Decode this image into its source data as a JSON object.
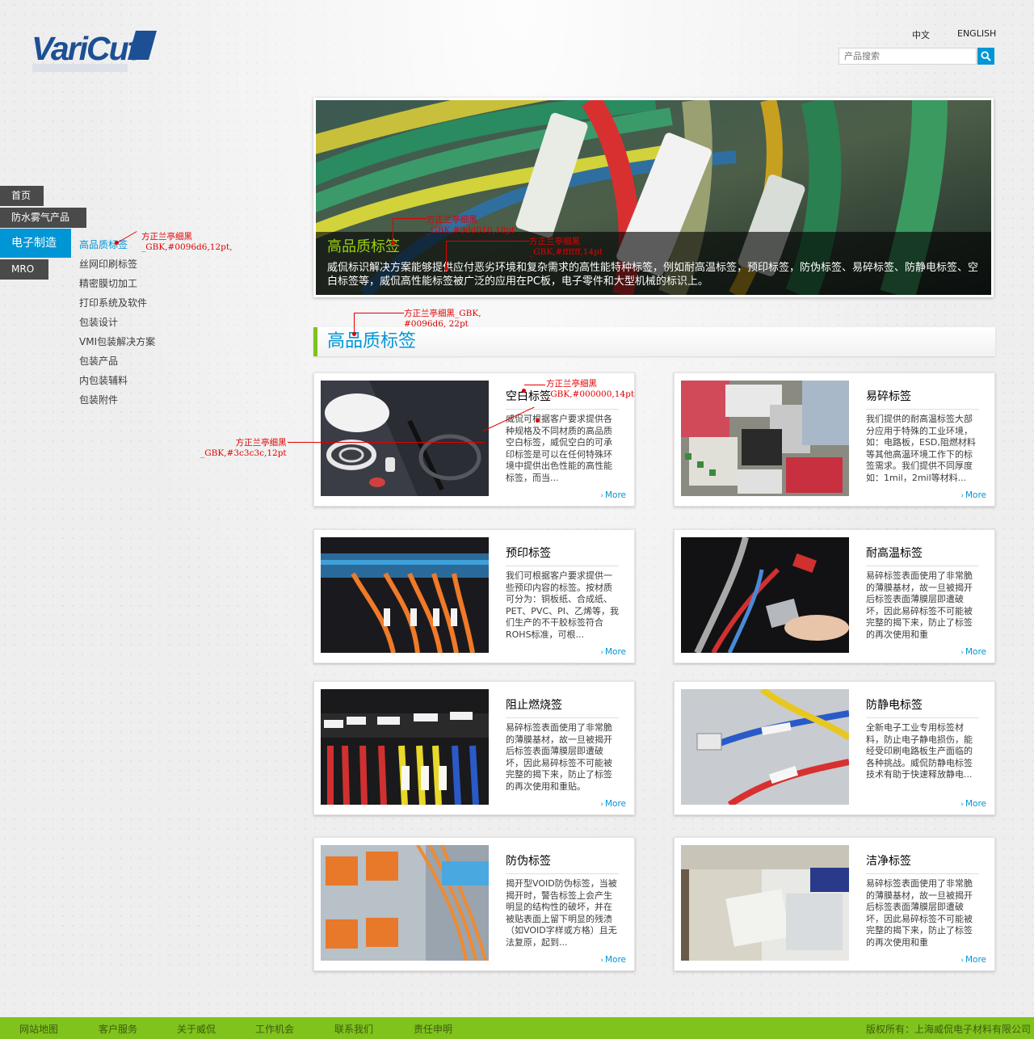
{
  "brand": {
    "logo_text": "VariCut",
    "accent": "#0096d6",
    "green": "#7fc31c"
  },
  "header": {
    "lang_zh": "中文",
    "lang_en": "ENGLISH",
    "search_placeholder": "产品搜索",
    "search_icon": "search-icon"
  },
  "nav": {
    "items": [
      {
        "label": "首页"
      },
      {
        "label": "防水雾气产品"
      },
      {
        "label": "电子制造"
      },
      {
        "label": "MRO"
      }
    ],
    "sub_items": [
      {
        "label": "高品质标签"
      },
      {
        "label": "丝网印刷标签"
      },
      {
        "label": "精密膜切加工"
      },
      {
        "label": "打印系统及软件"
      },
      {
        "label": "包装设计"
      },
      {
        "label": "VMI包装解决方案"
      },
      {
        "label": "包装产品"
      },
      {
        "label": "内包装辅料"
      },
      {
        "label": "包装附件"
      }
    ]
  },
  "annotations": {
    "a1_l1": "方正兰亭细黑",
    "a1_l2": "_GBK,#0096d6,12pt,",
    "a2_l1": "方正兰亭细黑",
    "a2_l2": "_GBK,#9dd010,18pt",
    "a3_l1": "方正兰亭细黑",
    "a3_l2": "_GBK,#ffffff,14pt",
    "a4_l1": "方正兰亭细黑_GBK,",
    "a4_l2": "#0096d6, 22pt",
    "a5_l1": "方正兰亭细黑",
    "a5_l2": "_GBK,#000000,14pt",
    "a6_l1": "方正兰亭细黑",
    "a6_l2": "_GBK,#3c3c3c,12pt"
  },
  "banner": {
    "title": "高品质标签",
    "text": "威侃标识解决方案能够提供应付恶劣环境和复杂需求的高性能特种标签，例如耐高温标签，预印标签，防伪标签、易碎标签、防静电标签、空白标签等，威侃高性能标签被广泛的应用在PC板，电子零件和大型机械的标识上。"
  },
  "section": {
    "title": "高品质标签"
  },
  "products": [
    {
      "title": "空白标签",
      "desc": "威侃可根据客户要求提供各种规格及不同材质的高品质空白标签，威侃空白的可承印标签是可以在任何特殊环境中提供出色性能的高性能标签，而当...",
      "more": "More"
    },
    {
      "title": "易碎标签",
      "desc": "我们提供的耐高温标签大部分应用于特殊的工业环境，如：电路板，ESD,阻燃材料等其他高温环境工作下的标签需求。我们提供不同厚度如：1mil，2mil等材料...",
      "more": "More"
    },
    {
      "title": "预印标签",
      "desc": "我们可根据客户要求提供一些预印内容的标签。按材质可分为：铜板纸、合成纸、PET、PVC、PI、乙烯等，我们生产的不干胶标签符合ROHS标准，可根...",
      "more": "More"
    },
    {
      "title": "耐高温标签",
      "desc": "易碎标签表面使用了非常脆的薄膜基材，故一旦被揭开后标签表面薄膜层即遭破坏，因此易碎标签不可能被完整的揭下来，防止了标签的再次使用和重",
      "more": "More"
    },
    {
      "title": "阻止燃烧签",
      "desc": "易碎标签表面使用了非常脆的薄膜基材，故一旦被揭开后标签表面薄膜层即遭破坏，因此易碎标签不可能被完整的揭下来，防止了标签的再次使用和重贴。",
      "more": "More"
    },
    {
      "title": "防静电标签",
      "desc": "全新电子工业专用标签材料，防止电子静电损伤，能经受印刷电路板生产面临的各种挑战。威侃防静电标签技术有助于快速释放静电...",
      "more": "More"
    },
    {
      "title": "防伪标签",
      "desc": "揭开型VOID防伪标签，当被揭开时，警告标签上会产生明显的结构性的破坏，并在被贴表面上留下明显的残渍（如VOID字样或方格）且无法复原，起到...",
      "more": "More"
    },
    {
      "title": "洁净标签",
      "desc": "易碎标签表面使用了非常脆的薄膜基材，故一旦被揭开后标签表面薄膜层即遭破坏，因此易碎标签不可能被完整的揭下来，防止了标签的再次使用和重",
      "more": "More"
    }
  ],
  "footer": {
    "links": [
      {
        "label": "网站地图"
      },
      {
        "label": "客户服务"
      },
      {
        "label": "关于威侃"
      },
      {
        "label": "工作机会"
      },
      {
        "label": "联系我们"
      },
      {
        "label": "责任申明"
      }
    ],
    "copyright": "版权所有：上海威侃电子材料有限公司"
  }
}
